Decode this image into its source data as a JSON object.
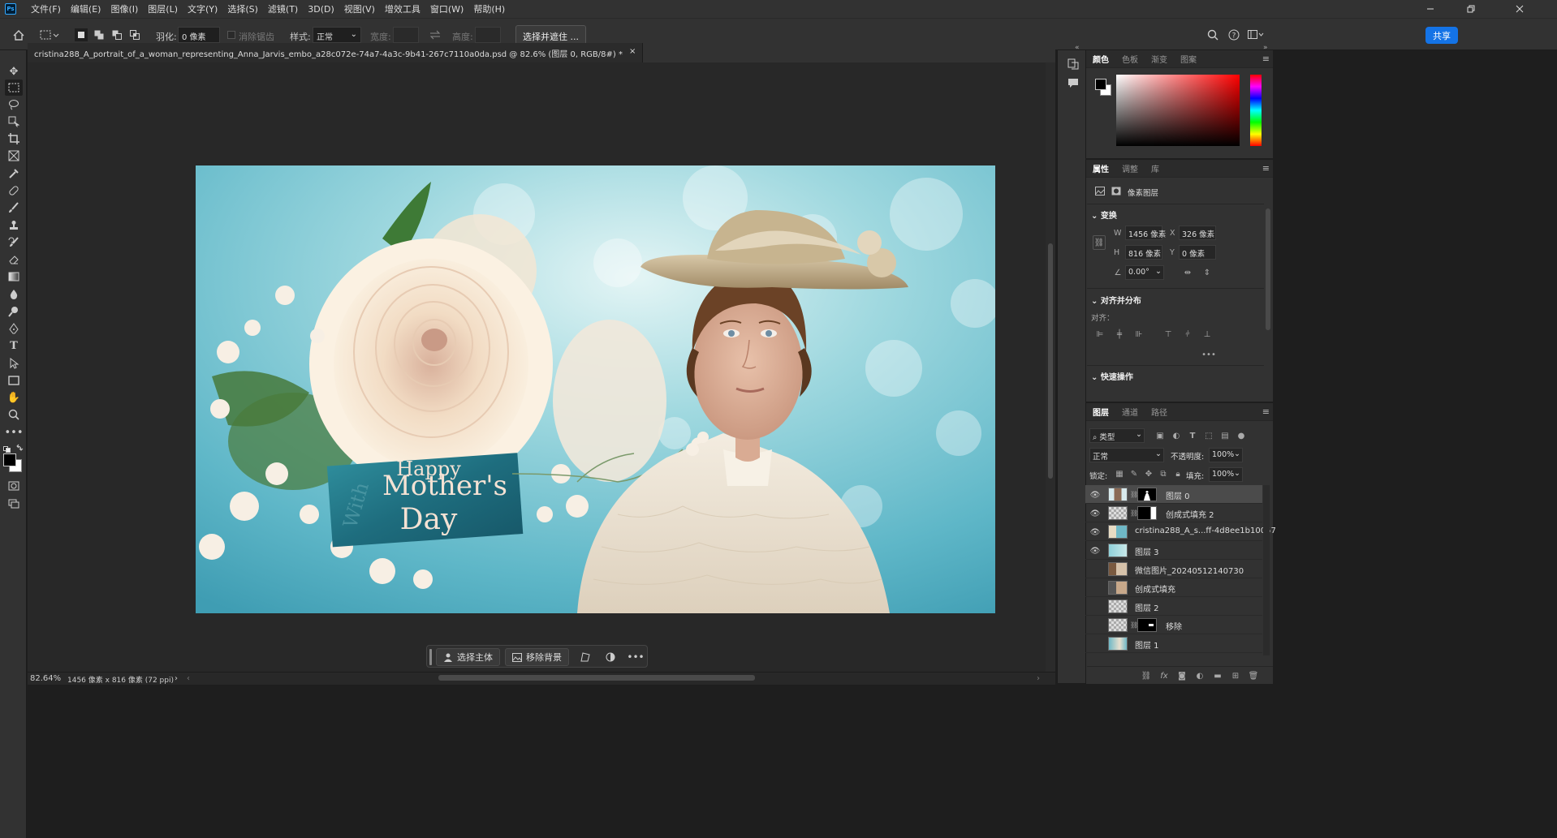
{
  "app": {
    "logo": "Ps"
  },
  "menu": [
    "文件(F)",
    "编辑(E)",
    "图像(I)",
    "图层(L)",
    "文字(Y)",
    "选择(S)",
    "滤镜(T)",
    "3D(D)",
    "视图(V)",
    "增效工具",
    "窗口(W)",
    "帮助(H)"
  ],
  "options": {
    "feather_label": "羽化:",
    "feather_value": "0 像素",
    "antialias_label": "消除锯齿",
    "style_label": "样式:",
    "style_value": "正常",
    "width_label": "宽度:",
    "height_label": "高度:",
    "select_mask_label": "选择并遮住 ...",
    "share_label": "共享"
  },
  "document": {
    "tab_title": "cristina288_A_portrait_of_a_woman_representing_Anna_Jarvis_embo_a28c072e-74a7-4a3c-9b41-267c7110a0da.psd @ 82.6% (图层 0, RGB/8#) *",
    "card_line1": "Happy",
    "card_line2": "Mother's",
    "card_line3": "Day"
  },
  "status": {
    "zoom": "82.64%",
    "size": "1456 像素 x 816 像素 (72 ppi)"
  },
  "taskbar": {
    "select_subject": "选择主体",
    "remove_bg": "移除背景"
  },
  "color_panel": {
    "tabs": [
      "颜色",
      "色板",
      "渐变",
      "图案"
    ],
    "active": "颜色"
  },
  "properties_panel": {
    "tabs": [
      "属性",
      "调整",
      "库"
    ],
    "layer_type": "像素图层",
    "transform_title": "变换",
    "w_label": "W",
    "w_value": "1456 像素",
    "h_label": "H",
    "h_value": "816 像素",
    "x_label": "X",
    "x_value": "326 像素",
    "y_label": "Y",
    "y_value": "0 像素",
    "angle_value": "0.00°",
    "align_title": "对齐并分布",
    "align_label": "对齐：",
    "quick_actions_title": "快速操作"
  },
  "layers_panel": {
    "tabs": [
      "图层",
      "通道",
      "路径"
    ],
    "filter_value": "类型",
    "blend_mode": "正常",
    "opacity_label": "不透明度:",
    "opacity_value": "100%",
    "lock_label": "锁定:",
    "fill_label": "填充:",
    "fill_value": "100%",
    "layers": [
      {
        "name": "图层 0",
        "visible": true,
        "selected": true
      },
      {
        "name": "创成式填充 2",
        "visible": true,
        "selected": false
      },
      {
        "name": "cristina288_A_s...ff-4d8ee1b10057",
        "visible": true,
        "selected": false
      },
      {
        "name": "图层 3",
        "visible": true,
        "selected": false
      },
      {
        "name": "微信图片_20240512140730",
        "visible": false,
        "selected": false
      },
      {
        "name": "创成式填充",
        "visible": false,
        "selected": false
      },
      {
        "name": "图层 2",
        "visible": false,
        "selected": false
      },
      {
        "name": "移除",
        "visible": false,
        "selected": false
      },
      {
        "name": "图层 1",
        "visible": false,
        "selected": false
      }
    ]
  },
  "colors": {
    "accent": "#1473e6",
    "panel_bg": "#323232",
    "canvas_bg": "#282828"
  }
}
